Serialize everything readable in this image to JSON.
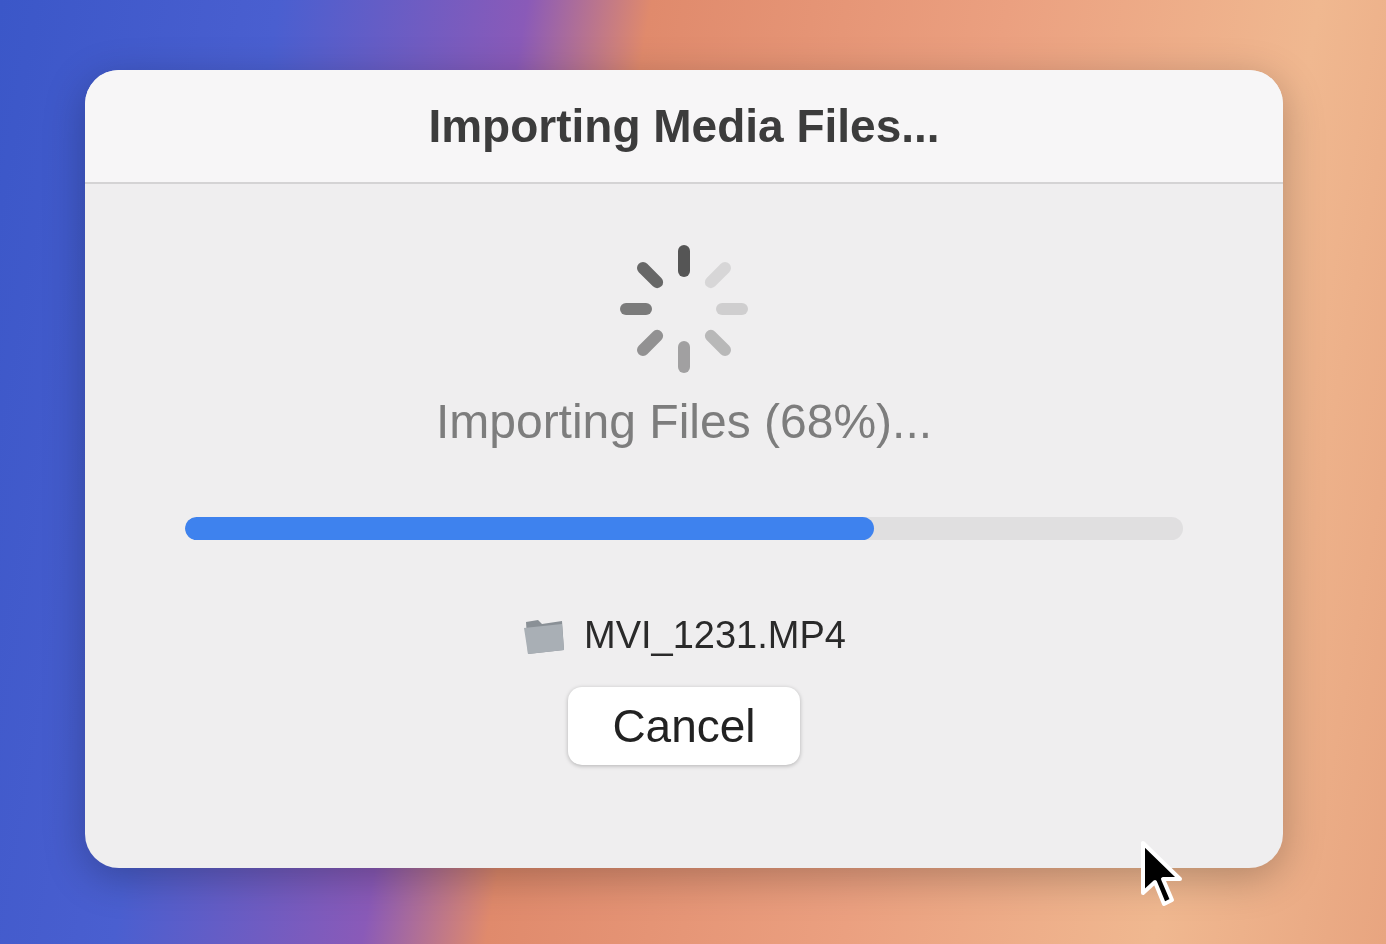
{
  "dialog": {
    "title": "Importing Media Files...",
    "status": "Importing Files (68%)...",
    "progress": {
      "level": 0.69
    },
    "file_name": "MVI_1231.MP4",
    "buttons": [
      {
        "label": "Cancel"
      }
    ]
  }
}
